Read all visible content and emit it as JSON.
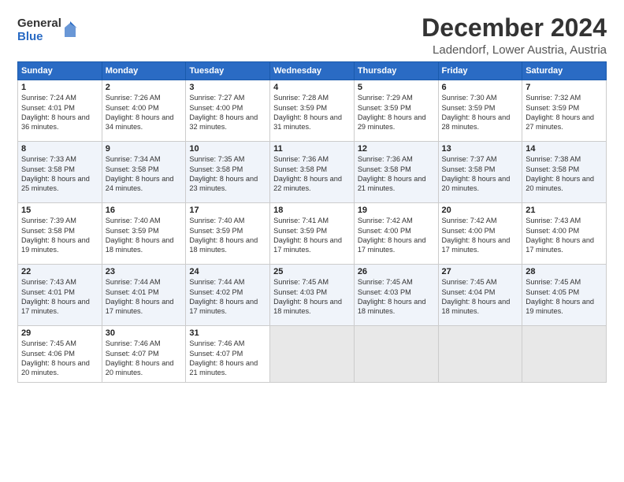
{
  "logo": {
    "general": "General",
    "blue": "Blue"
  },
  "title": "December 2024",
  "location": "Ladendorf, Lower Austria, Austria",
  "days_of_week": [
    "Sunday",
    "Monday",
    "Tuesday",
    "Wednesday",
    "Thursday",
    "Friday",
    "Saturday"
  ],
  "weeks": [
    [
      {
        "day": "1",
        "sunrise": "Sunrise: 7:24 AM",
        "sunset": "Sunset: 4:01 PM",
        "daylight": "Daylight: 8 hours and 36 minutes."
      },
      {
        "day": "2",
        "sunrise": "Sunrise: 7:26 AM",
        "sunset": "Sunset: 4:00 PM",
        "daylight": "Daylight: 8 hours and 34 minutes."
      },
      {
        "day": "3",
        "sunrise": "Sunrise: 7:27 AM",
        "sunset": "Sunset: 4:00 PM",
        "daylight": "Daylight: 8 hours and 32 minutes."
      },
      {
        "day": "4",
        "sunrise": "Sunrise: 7:28 AM",
        "sunset": "Sunset: 3:59 PM",
        "daylight": "Daylight: 8 hours and 31 minutes."
      },
      {
        "day": "5",
        "sunrise": "Sunrise: 7:29 AM",
        "sunset": "Sunset: 3:59 PM",
        "daylight": "Daylight: 8 hours and 29 minutes."
      },
      {
        "day": "6",
        "sunrise": "Sunrise: 7:30 AM",
        "sunset": "Sunset: 3:59 PM",
        "daylight": "Daylight: 8 hours and 28 minutes."
      },
      {
        "day": "7",
        "sunrise": "Sunrise: 7:32 AM",
        "sunset": "Sunset: 3:59 PM",
        "daylight": "Daylight: 8 hours and 27 minutes."
      }
    ],
    [
      {
        "day": "8",
        "sunrise": "Sunrise: 7:33 AM",
        "sunset": "Sunset: 3:58 PM",
        "daylight": "Daylight: 8 hours and 25 minutes."
      },
      {
        "day": "9",
        "sunrise": "Sunrise: 7:34 AM",
        "sunset": "Sunset: 3:58 PM",
        "daylight": "Daylight: 8 hours and 24 minutes."
      },
      {
        "day": "10",
        "sunrise": "Sunrise: 7:35 AM",
        "sunset": "Sunset: 3:58 PM",
        "daylight": "Daylight: 8 hours and 23 minutes."
      },
      {
        "day": "11",
        "sunrise": "Sunrise: 7:36 AM",
        "sunset": "Sunset: 3:58 PM",
        "daylight": "Daylight: 8 hours and 22 minutes."
      },
      {
        "day": "12",
        "sunrise": "Sunrise: 7:36 AM",
        "sunset": "Sunset: 3:58 PM",
        "daylight": "Daylight: 8 hours and 21 minutes."
      },
      {
        "day": "13",
        "sunrise": "Sunrise: 7:37 AM",
        "sunset": "Sunset: 3:58 PM",
        "daylight": "Daylight: 8 hours and 20 minutes."
      },
      {
        "day": "14",
        "sunrise": "Sunrise: 7:38 AM",
        "sunset": "Sunset: 3:58 PM",
        "daylight": "Daylight: 8 hours and 20 minutes."
      }
    ],
    [
      {
        "day": "15",
        "sunrise": "Sunrise: 7:39 AM",
        "sunset": "Sunset: 3:58 PM",
        "daylight": "Daylight: 8 hours and 19 minutes."
      },
      {
        "day": "16",
        "sunrise": "Sunrise: 7:40 AM",
        "sunset": "Sunset: 3:59 PM",
        "daylight": "Daylight: 8 hours and 18 minutes."
      },
      {
        "day": "17",
        "sunrise": "Sunrise: 7:40 AM",
        "sunset": "Sunset: 3:59 PM",
        "daylight": "Daylight: 8 hours and 18 minutes."
      },
      {
        "day": "18",
        "sunrise": "Sunrise: 7:41 AM",
        "sunset": "Sunset: 3:59 PM",
        "daylight": "Daylight: 8 hours and 17 minutes."
      },
      {
        "day": "19",
        "sunrise": "Sunrise: 7:42 AM",
        "sunset": "Sunset: 4:00 PM",
        "daylight": "Daylight: 8 hours and 17 minutes."
      },
      {
        "day": "20",
        "sunrise": "Sunrise: 7:42 AM",
        "sunset": "Sunset: 4:00 PM",
        "daylight": "Daylight: 8 hours and 17 minutes."
      },
      {
        "day": "21",
        "sunrise": "Sunrise: 7:43 AM",
        "sunset": "Sunset: 4:00 PM",
        "daylight": "Daylight: 8 hours and 17 minutes."
      }
    ],
    [
      {
        "day": "22",
        "sunrise": "Sunrise: 7:43 AM",
        "sunset": "Sunset: 4:01 PM",
        "daylight": "Daylight: 8 hours and 17 minutes."
      },
      {
        "day": "23",
        "sunrise": "Sunrise: 7:44 AM",
        "sunset": "Sunset: 4:01 PM",
        "daylight": "Daylight: 8 hours and 17 minutes."
      },
      {
        "day": "24",
        "sunrise": "Sunrise: 7:44 AM",
        "sunset": "Sunset: 4:02 PM",
        "daylight": "Daylight: 8 hours and 17 minutes."
      },
      {
        "day": "25",
        "sunrise": "Sunrise: 7:45 AM",
        "sunset": "Sunset: 4:03 PM",
        "daylight": "Daylight: 8 hours and 18 minutes."
      },
      {
        "day": "26",
        "sunrise": "Sunrise: 7:45 AM",
        "sunset": "Sunset: 4:03 PM",
        "daylight": "Daylight: 8 hours and 18 minutes."
      },
      {
        "day": "27",
        "sunrise": "Sunrise: 7:45 AM",
        "sunset": "Sunset: 4:04 PM",
        "daylight": "Daylight: 8 hours and 18 minutes."
      },
      {
        "day": "28",
        "sunrise": "Sunrise: 7:45 AM",
        "sunset": "Sunset: 4:05 PM",
        "daylight": "Daylight: 8 hours and 19 minutes."
      }
    ],
    [
      {
        "day": "29",
        "sunrise": "Sunrise: 7:45 AM",
        "sunset": "Sunset: 4:06 PM",
        "daylight": "Daylight: 8 hours and 20 minutes."
      },
      {
        "day": "30",
        "sunrise": "Sunrise: 7:46 AM",
        "sunset": "Sunset: 4:07 PM",
        "daylight": "Daylight: 8 hours and 20 minutes."
      },
      {
        "day": "31",
        "sunrise": "Sunrise: 7:46 AM",
        "sunset": "Sunset: 4:07 PM",
        "daylight": "Daylight: 8 hours and 21 minutes."
      },
      null,
      null,
      null,
      null
    ]
  ]
}
